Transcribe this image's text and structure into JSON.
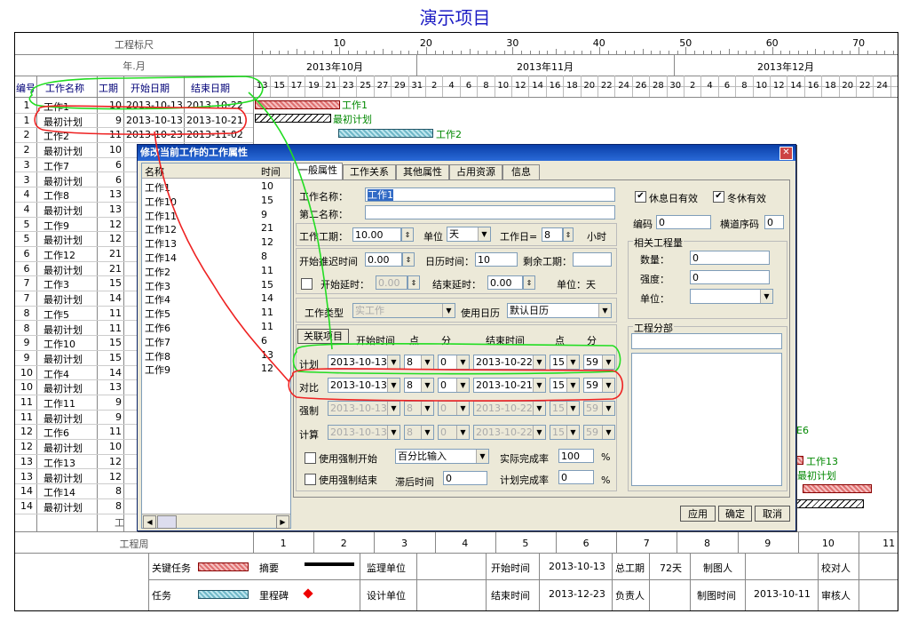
{
  "page_title": "演示项目",
  "header": {
    "scale_label": "工程标尺",
    "month_label": "年.月",
    "week_label": "工程周",
    "col_id": "编号",
    "col_name": "工作名称",
    "col_duration": "工期",
    "col_start": "开始日期",
    "col_end": "结束日期",
    "scale_ticks": [
      "10",
      "20",
      "30",
      "40",
      "50",
      "60",
      "70"
    ],
    "months": [
      "2013年10月",
      "2013年11月",
      "2013年12月"
    ],
    "days": [
      "13",
      "15",
      "17",
      "19",
      "21",
      "23",
      "25",
      "27",
      "29",
      "31",
      "2",
      "4",
      "6",
      "8",
      "10",
      "12",
      "14",
      "16",
      "18",
      "20",
      "22",
      "24",
      "26",
      "28",
      "30",
      "2",
      "4",
      "6",
      "8",
      "10",
      "12",
      "14",
      "16",
      "18",
      "20",
      "22",
      "24"
    ],
    "weeks": [
      "1",
      "2",
      "3",
      "4",
      "5",
      "6",
      "7",
      "8",
      "9",
      "10",
      "11"
    ]
  },
  "rows": [
    {
      "id": "1",
      "name": "工作1",
      "dur": "10",
      "start": "2013-10-13",
      "end": "2013-10-22"
    },
    {
      "id": "1",
      "name": "最初计划",
      "dur": "9",
      "start": "2013-10-13",
      "end": "2013-10-21"
    },
    {
      "id": "2",
      "name": "工作2",
      "dur": "11",
      "start": "2013-10-23",
      "end": "2013-11-02"
    },
    {
      "id": "2",
      "name": "最初计划",
      "dur": "10",
      "start": "",
      "end": ""
    },
    {
      "id": "3",
      "name": "工作7",
      "dur": "6",
      "start": "",
      "end": ""
    },
    {
      "id": "3",
      "name": "最初计划",
      "dur": "6",
      "start": "",
      "end": ""
    },
    {
      "id": "4",
      "name": "工作8",
      "dur": "13",
      "start": "",
      "end": ""
    },
    {
      "id": "4",
      "name": "最初计划",
      "dur": "13",
      "start": "",
      "end": ""
    },
    {
      "id": "5",
      "name": "工作9",
      "dur": "12",
      "start": "",
      "end": ""
    },
    {
      "id": "5",
      "name": "最初计划",
      "dur": "12",
      "start": "",
      "end": ""
    },
    {
      "id": "6",
      "name": "工作12",
      "dur": "21",
      "start": "",
      "end": ""
    },
    {
      "id": "6",
      "name": "最初计划",
      "dur": "21",
      "start": "",
      "end": ""
    },
    {
      "id": "7",
      "name": "工作3",
      "dur": "15",
      "start": "",
      "end": ""
    },
    {
      "id": "7",
      "name": "最初计划",
      "dur": "14",
      "start": "",
      "end": ""
    },
    {
      "id": "8",
      "name": "工作5",
      "dur": "11",
      "start": "",
      "end": ""
    },
    {
      "id": "8",
      "name": "最初计划",
      "dur": "11",
      "start": "",
      "end": ""
    },
    {
      "id": "9",
      "name": "工作10",
      "dur": "15",
      "start": "",
      "end": ""
    },
    {
      "id": "9",
      "name": "最初计划",
      "dur": "15",
      "start": "",
      "end": ""
    },
    {
      "id": "10",
      "name": "工作4",
      "dur": "14",
      "start": "",
      "end": ""
    },
    {
      "id": "10",
      "name": "最初计划",
      "dur": "13",
      "start": "",
      "end": ""
    },
    {
      "id": "11",
      "name": "工作11",
      "dur": "9",
      "start": "",
      "end": ""
    },
    {
      "id": "11",
      "name": "最初计划",
      "dur": "9",
      "start": "",
      "end": ""
    },
    {
      "id": "12",
      "name": "工作6",
      "dur": "11",
      "start": "",
      "end": ""
    },
    {
      "id": "12",
      "name": "最初计划",
      "dur": "10",
      "start": "",
      "end": ""
    },
    {
      "id": "13",
      "name": "工作13",
      "dur": "12",
      "start": "",
      "end": ""
    },
    {
      "id": "13",
      "name": "最初计划",
      "dur": "12",
      "start": "",
      "end": ""
    },
    {
      "id": "14",
      "name": "工作14",
      "dur": "8",
      "start": "",
      "end": ""
    },
    {
      "id": "14",
      "name": "最初计划",
      "dur": "8",
      "start": "",
      "end": ""
    }
  ],
  "footer_partial": "工",
  "bar_labels": {
    "w1": "工作1",
    "p1": "最初计划",
    "w2": "工作2",
    "w6": "E6",
    "w13": "工作13",
    "p13": "最初计划"
  },
  "legend": {
    "critical": "关键任务",
    "summary": "摘要",
    "supervisor": "监理单位",
    "start_time": "开始时间",
    "start_val": "2013-10-13",
    "total_dur": "总工期",
    "total_val": "72天",
    "drafter": "制图人",
    "checker": "校对人",
    "task": "任务",
    "milestone": "里程碑",
    "design": "设计单位",
    "end_time": "结束时间",
    "end_val": "2013-12-23",
    "owner": "负责人",
    "draw_time": "制图时间",
    "draw_val": "2013-10-11",
    "reviewer": "审核人"
  },
  "dialog": {
    "title": "修改当前工作的工作属性",
    "close": "✕",
    "list_head_name": "名称",
    "list_head_time": "时间",
    "list": [
      {
        "name": "工作1",
        "time": "10"
      },
      {
        "name": "工作10",
        "time": "15"
      },
      {
        "name": "工作11",
        "time": "9"
      },
      {
        "name": "工作12",
        "time": "21"
      },
      {
        "name": "工作13",
        "time": "12"
      },
      {
        "name": "工作14",
        "time": "8"
      },
      {
        "name": "工作2",
        "time": "11"
      },
      {
        "name": "工作3",
        "time": "15"
      },
      {
        "name": "工作4",
        "time": "14"
      },
      {
        "name": "工作5",
        "time": "11"
      },
      {
        "name": "工作6",
        "time": "11"
      },
      {
        "name": "工作7",
        "time": "6"
      },
      {
        "name": "工作8",
        "time": "13"
      },
      {
        "name": "工作9",
        "time": "12"
      }
    ],
    "tabs": [
      "一般属性",
      "工作关系",
      "其他属性",
      "占用资源",
      "信息"
    ],
    "name_label": "工作名称：",
    "name_val": "工作1",
    "second_name_label": "第二名称：",
    "duration_label": "工作工期：",
    "duration_val": "10.00",
    "unit_label": "单位",
    "unit_val": "天",
    "workday_label": "工作日=",
    "workday_val": "8",
    "hour_label": "小时",
    "start_delay_label": "开始推迟时间",
    "start_delay_val": "0.00",
    "calendar_time_label": "日历时间：",
    "calendar_time_val": "10",
    "remain_label": "剩余工期：",
    "start_lag_label": "开始延时：",
    "start_lag_val": "0.00",
    "end_lag_label": "结束延时：",
    "end_lag_val": "0.00",
    "unit_day": "单位：天",
    "work_type_label": "工作类型",
    "work_type_val": "实工作",
    "use_calendar_label": "使用日历",
    "use_calendar_val": "默认日历",
    "link_btn": "关联项目",
    "start_time_hdr": "开始时间",
    "hour_hdr": "点",
    "min_hdr": "分",
    "end_time_hdr": "结束时间",
    "plan_label": "计划",
    "plan": {
      "sd": "2013-10-13",
      "sh": "8",
      "sm": "0",
      "ed": "2013-10-22",
      "eh": "15",
      "em": "59"
    },
    "compare_label": "对比",
    "compare": {
      "sd": "2013-10-13",
      "sh": "8",
      "sm": "0",
      "ed": "2013-10-21",
      "eh": "15",
      "em": "59"
    },
    "force_label": "强制",
    "force": {
      "sd": "2013-10-13",
      "sh": "8",
      "sm": "0",
      "ed": "2013-10-22",
      "eh": "15",
      "em": "59"
    },
    "calc_label": "计算",
    "calc": {
      "sd": "2013-10-13",
      "sh": "8",
      "sm": "0",
      "ed": "2013-10-22",
      "eh": "15",
      "em": "59"
    },
    "use_force_start": "使用强制开始",
    "use_force_end": "使用强制结束",
    "percent_input": "百分比输入",
    "actual_rate_label": "实际完成率",
    "actual_rate_val": "100",
    "pct": "%",
    "lag_time_label": "滞后时间",
    "lag_time_val": "0",
    "plan_rate_label": "计划完成率",
    "plan_rate_val": "0",
    "rest_day_label": "休息日有效",
    "winter_label": "冬休有效",
    "code_label": "编码",
    "code_val": "0",
    "lane_label": "横道序码",
    "lane_val": "0",
    "qty_group": "相关工程量",
    "qty_label": "数量：",
    "qty_val": "0",
    "intensity_label": "强度：",
    "intensity_val": "0",
    "unit2_label": "单位：",
    "division_label": "工程分部",
    "apply": "应用",
    "ok": "确定",
    "cancel": "取消"
  },
  "colors": {
    "title": "#1c1cc4",
    "dialog_bg": "#ece9d8",
    "critical_bar": "#e07070",
    "task_bar": "#6fb8c8",
    "annotation_green": "#22dd22",
    "annotation_red": "#ee2222"
  }
}
